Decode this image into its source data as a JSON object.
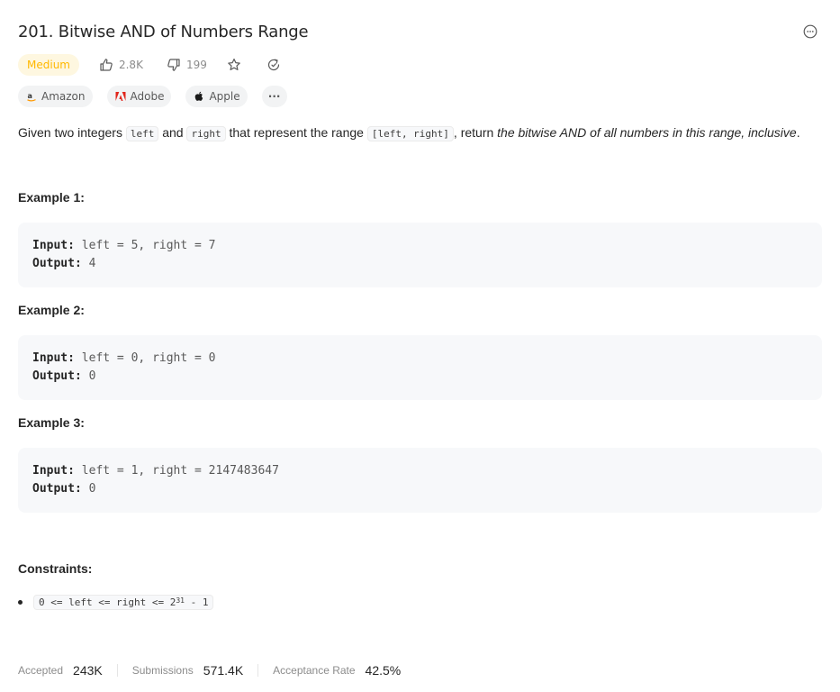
{
  "problem": {
    "title": "201. Bitwise AND of Numbers Range",
    "difficulty": "Medium",
    "likes": "2.8K",
    "dislikes": "199"
  },
  "companies": [
    {
      "name": "Amazon",
      "icon": "amazon-logo"
    },
    {
      "name": "Adobe",
      "icon": "adobe-logo"
    },
    {
      "name": "Apple",
      "icon": "apple-logo"
    }
  ],
  "more_companies": "···",
  "description": {
    "part1": "Given two integers ",
    "code1": "left",
    "part2": " and ",
    "code2": "right",
    "part3": " that represent the range ",
    "code3": "[left, right]",
    "part4": ", return ",
    "emphasis": "the bitwise AND of all numbers in this range, inclusive",
    "part5": "."
  },
  "examples": [
    {
      "title": "Example 1:",
      "input_label": "Input:",
      "input": "left = 5, right = 7",
      "output_label": "Output:",
      "output": "4"
    },
    {
      "title": "Example 2:",
      "input_label": "Input:",
      "input": "left = 0, right = 0",
      "output_label": "Output:",
      "output": "0"
    },
    {
      "title": "Example 3:",
      "input_label": "Input:",
      "input": "left = 1, right = 2147483647",
      "output_label": "Output:",
      "output": "0"
    }
  ],
  "constraints": {
    "title": "Constraints:",
    "items": [
      {
        "prefix": "0 <= left <= right <= 2",
        "sup": "31",
        "suffix": " - 1"
      }
    ]
  },
  "stats": [
    {
      "label": "Accepted",
      "value": "243K"
    },
    {
      "label": "Submissions",
      "value": "571.4K"
    },
    {
      "label": "Acceptance Rate",
      "value": "42.5%"
    }
  ],
  "colors": {
    "difficulty_medium": "#ffb800",
    "difficulty_bg": "#fef7e0",
    "code_bg": "#f7f8fa"
  }
}
